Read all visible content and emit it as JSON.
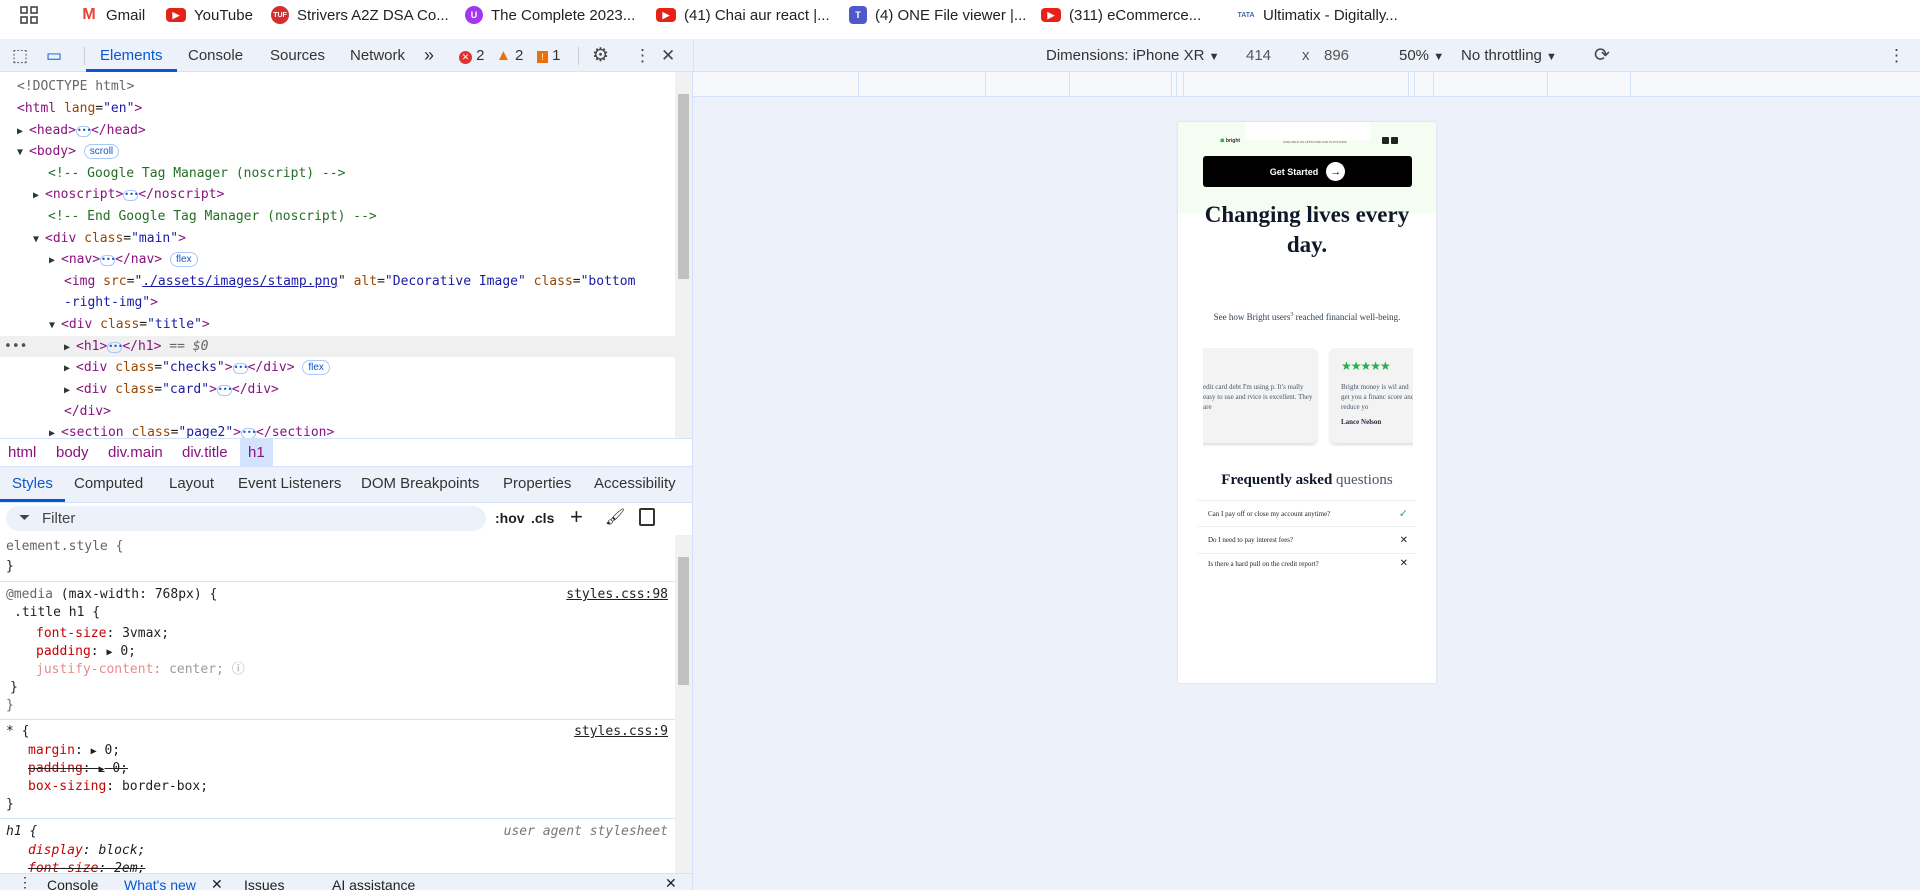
{
  "bookmarks": [
    {
      "label": "Gmail",
      "icon": "gmail-icon"
    },
    {
      "label": "YouTube",
      "icon": "youtube-icon"
    },
    {
      "label": "Strivers A2Z DSA Co...",
      "icon": "tuf-icon"
    },
    {
      "label": "The Complete 2023...",
      "icon": "udemy-icon"
    },
    {
      "label": "(41) Chai aur react |...",
      "icon": "youtube-icon"
    },
    {
      "label": "(4) ONE File viewer |...",
      "icon": "teams-icon"
    },
    {
      "label": "(311) eCommerce...",
      "icon": "youtube-icon"
    },
    {
      "label": "Ultimatix - Digitally...",
      "icon": "tata-icon"
    }
  ],
  "devtools": {
    "tabs": [
      "Elements",
      "Console",
      "Sources",
      "Network"
    ],
    "more": "»",
    "errors": "2",
    "warnings": "2",
    "issues": "1",
    "close": "✕"
  },
  "device_toolbar": {
    "dimensions": "Dimensions: iPhone XR",
    "width": "414",
    "x": "x",
    "height": "896",
    "zoom": "50%",
    "throttling": "No throttling"
  },
  "dom": {
    "doctype": "<!DOCTYPE html>",
    "html_open": "<html",
    "lang_attr": "lang",
    "lang_val": "\"en\"",
    "head": "<head>",
    "head_close": "</head>",
    "body": "<body>",
    "scroll": "scroll",
    "comment1": "<!-- Google Tag Manager (noscript) -->",
    "noscript": "<noscript>",
    "noscript_close": "</noscript>",
    "comment2": "<!-- End Google Tag Manager (noscript) -->",
    "div": "<div",
    "class": "class",
    "main_val": "\"main\"",
    "nav": "<nav>",
    "nav_close": "</nav>",
    "flex": "flex",
    "img": "<img",
    "src": "src",
    "src_val": "./assets/images/stamp.png",
    "alt": "alt",
    "alt_val": "\"Decorative Image\"",
    "img_class_val": "\"bottom",
    "img_class_val2": "-right-img\"",
    "title_val": "\"title\"",
    "h1": "<h1>",
    "h1_close": "</h1>",
    "selected": "== $0",
    "checks_val": "\"checks\"",
    "card_val": "\"card\"",
    "div_close": "</div>",
    "section": "<section",
    "page2_val": "\"page2\"",
    "section_close": "</section>"
  },
  "breadcrumb": [
    "html",
    "body",
    "div.main",
    "div.title",
    "h1"
  ],
  "style_tabs": [
    "Styles",
    "Computed",
    "Layout",
    "Event Listeners",
    "DOM Breakpoints",
    "Properties",
    "Accessibility"
  ],
  "filter": {
    "placeholder": "Filter",
    "hov": ":hov",
    "cls": ".cls"
  },
  "rules": {
    "element_style": "element.style {",
    "media": "@media",
    "media_q": "(max-width: 768px) {",
    "sel1": ".title h1 {",
    "src1": "styles.css:98",
    "p_fs": "font-size",
    "v_fs": "3vmax;",
    "p_pad": "padding",
    "v_pad": "0;",
    "p_jc": "justify-content",
    "v_jc": "center;",
    "sel2": "* {",
    "src2": "styles.css:9",
    "p_margin": "margin",
    "v_margin": "0;",
    "p_bs": "box-sizing",
    "v_bs": "border-box;",
    "sel3": "h1 {",
    "src3": "user agent stylesheet",
    "p_disp": "display",
    "v_disp": "block;",
    "p_fs2": "font-size",
    "v_fs2": "2em;",
    "close": "}"
  },
  "drawer": [
    "Console",
    "What's new",
    "Issues",
    "AI assistance"
  ],
  "page": {
    "logo": "bright",
    "available": "AVAILABLE ON APPSTORE AND PLAYSTORE",
    "cta": "Get Started",
    "title": "Changing lives every day.",
    "subtitle_a": "See how Bright users",
    "subtitle_sup": "3",
    "subtitle_b": " reached financial well-being.",
    "cards": [
      {
        "text": "edit card debt I'm using p. It's really easy to use and rvice is excellent. They are"
      },
      {
        "stars": "★★★★★",
        "text": "Bright money is wil and get you a financ score and reduce yo",
        "author": "Lance Nelson"
      }
    ],
    "faq_bold": "Frequently asked",
    "faq_light": " questions",
    "faq": [
      {
        "q": "Can I pay off or close my account anytime?",
        "mark": "✓",
        "color": "#22b14c"
      },
      {
        "q": "Do I need to pay interest fees?",
        "mark": "✕",
        "color": "#111"
      },
      {
        "q": "Is there a hard pull on the credit report?",
        "mark": "✕",
        "color": "#111"
      }
    ]
  }
}
